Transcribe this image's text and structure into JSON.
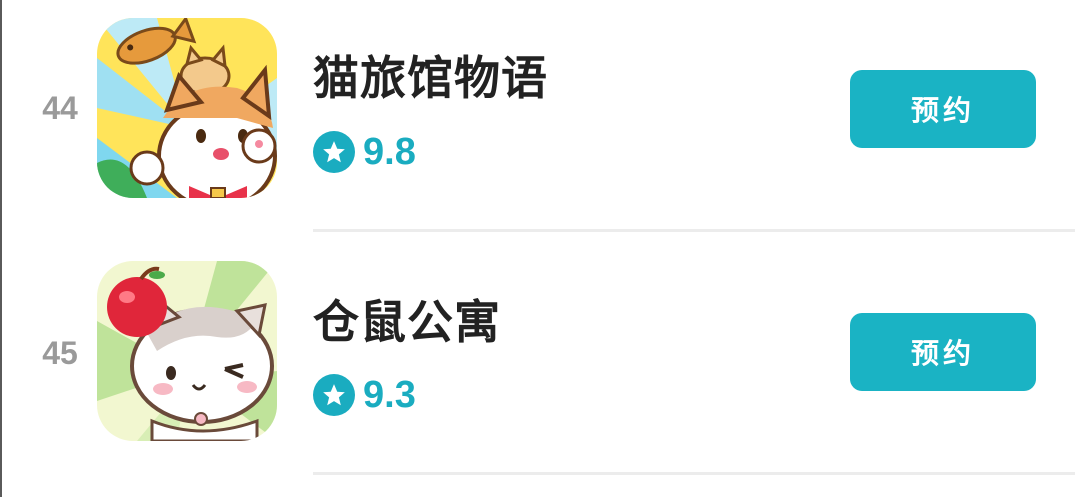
{
  "items": [
    {
      "rank": "44",
      "name": "猫旅馆物语",
      "rating": "9.8",
      "button_label": "预约",
      "icon": "cat-hotel-app-icon"
    },
    {
      "rank": "45",
      "name": "仓鼠公寓",
      "rating": "9.3",
      "button_label": "预约",
      "icon": "hamster-apartment-app-icon"
    }
  ],
  "colors": {
    "accent": "#1ab3c4",
    "rank_gray": "#9a9a9a",
    "title": "#222222",
    "divider": "#ececec"
  }
}
